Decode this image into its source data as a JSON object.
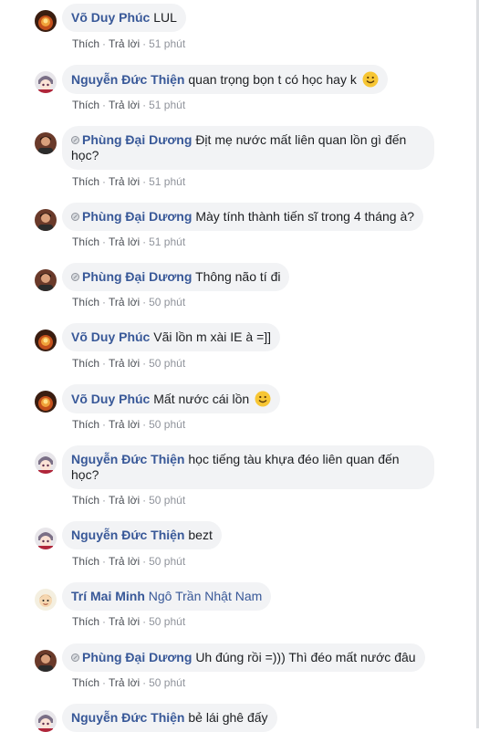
{
  "actions": {
    "like": "Thích",
    "reply": "Trả lời",
    "separator": "·"
  },
  "comments": [
    {
      "author": "Võ Duy Phúc",
      "text": "LUL",
      "time": "51 phút",
      "badge": false,
      "emoji": false,
      "avatar": "fire"
    },
    {
      "author": "Nguyễn Đức Thiện",
      "text": "quan trọng bọn t có học hay k",
      "time": "51 phút",
      "badge": false,
      "emoji": true,
      "avatar": "anime"
    },
    {
      "author": "Phùng Đại Dương",
      "text": "Địt mẹ nước mất liên quan lồn gì đến học?",
      "time": "51 phút",
      "badge": true,
      "emoji": false,
      "avatar": "person"
    },
    {
      "author": "Phùng Đại Dương",
      "text": "Mày tính thành tiến sĩ trong 4 tháng à?",
      "time": "51 phút",
      "badge": true,
      "emoji": false,
      "avatar": "person"
    },
    {
      "author": "Phùng Đại Dương",
      "text": "Thông não tí đi",
      "time": "50 phút",
      "badge": true,
      "emoji": false,
      "avatar": "person"
    },
    {
      "author": "Võ Duy Phúc",
      "text": "Vãi lồn m xài IE à =]]",
      "time": "50 phút",
      "badge": false,
      "emoji": false,
      "avatar": "fire"
    },
    {
      "author": "Võ Duy Phúc",
      "text": "Mất nước cái lồn",
      "time": "50 phút",
      "badge": false,
      "emoji": true,
      "avatar": "fire"
    },
    {
      "author": "Nguyễn Đức Thiện",
      "text": "học tiếng tàu khựa đéo liên quan đến học?",
      "time": "50 phút",
      "badge": false,
      "emoji": false,
      "avatar": "anime"
    },
    {
      "author": "Nguyễn Đức Thiện",
      "text": "bezt",
      "time": "50 phút",
      "badge": false,
      "emoji": false,
      "avatar": "anime"
    },
    {
      "author": "Trí Mai Minh",
      "text": "Ngô Trần Nhật Nam",
      "time": "50 phút",
      "badge": false,
      "emoji": false,
      "avatar": "cartoon"
    },
    {
      "author": "Phùng Đại Dương",
      "text": "Uh đúng rồi =))) Thì đéo mất nước đâu",
      "time": "50 phút",
      "badge": true,
      "emoji": false,
      "avatar": "person"
    },
    {
      "author": "Nguyễn Đức Thiện",
      "text": "bẻ lái ghê đấy",
      "time": "",
      "badge": false,
      "emoji": false,
      "avatar": "anime"
    }
  ],
  "colors": {
    "author": "#385898",
    "bubble": "#f2f3f5",
    "meta": "#90949c"
  }
}
